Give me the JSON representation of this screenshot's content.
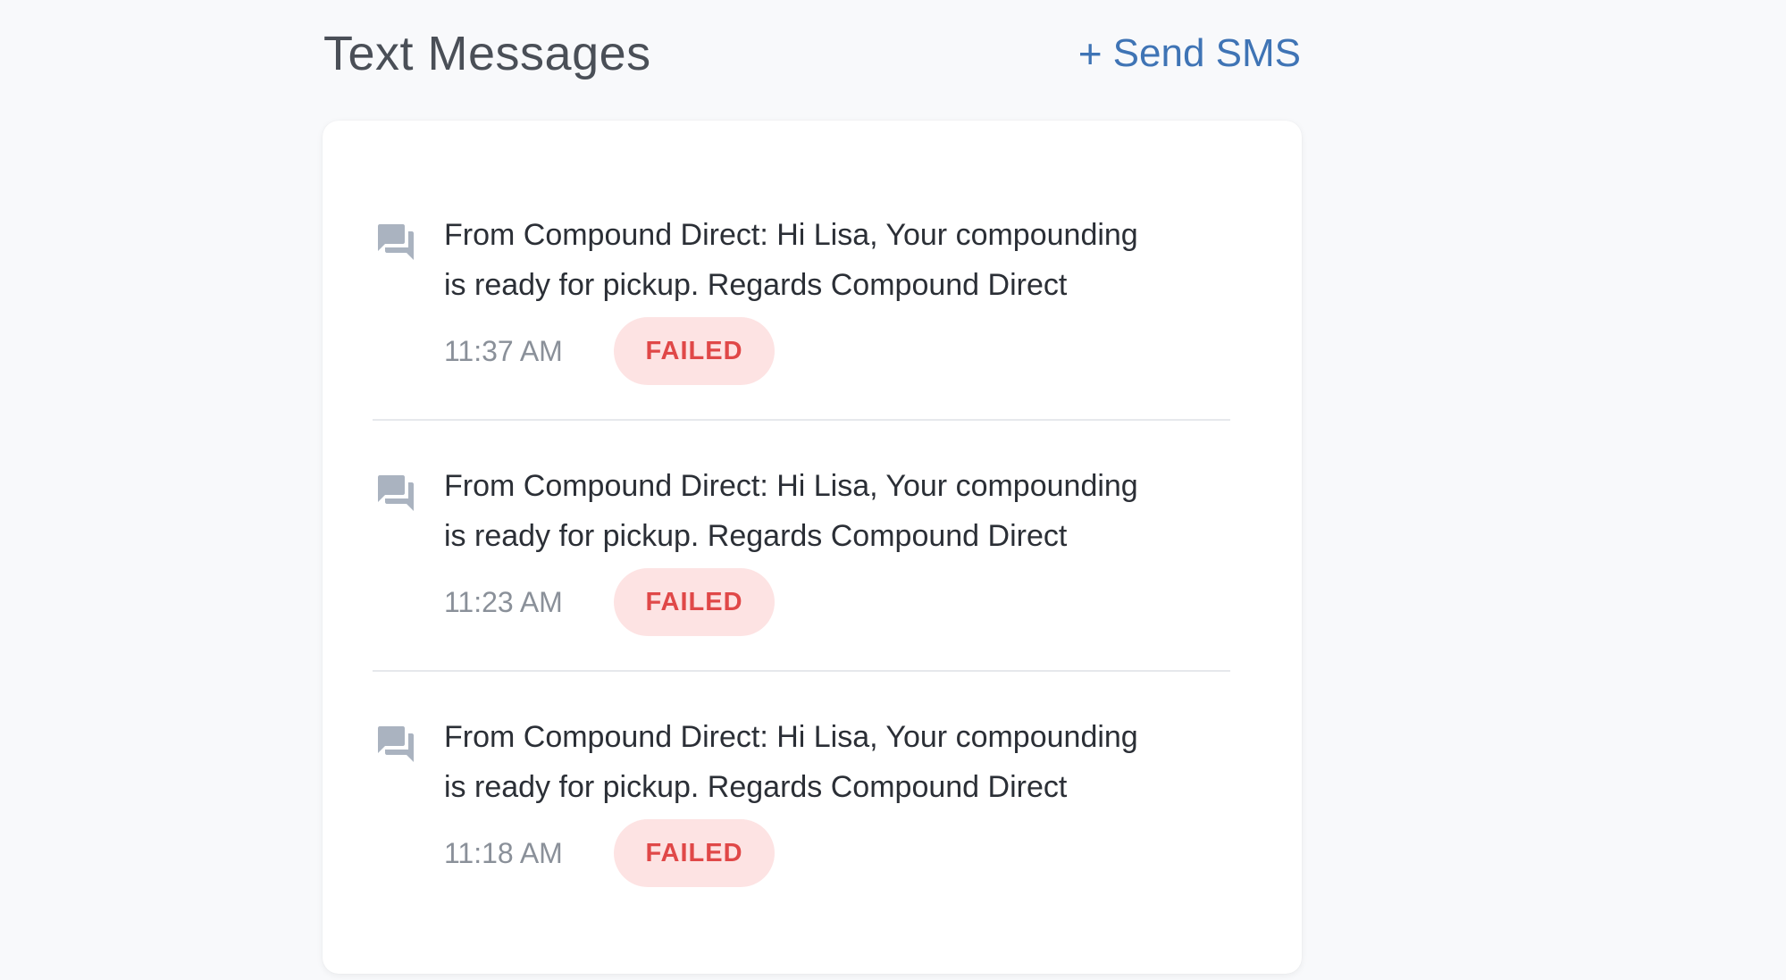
{
  "header": {
    "title": "Text Messages",
    "send_plus": "+",
    "send_label": "Send SMS"
  },
  "colors": {
    "accent": "#3f74b5",
    "failed_text": "#e04848",
    "failed_bg": "#fde3e3",
    "icon": "#aab3c0"
  },
  "messages": [
    {
      "icon": "chat-bubbles-icon",
      "line1": "From Compound Direct: Hi Lisa, Your compounding",
      "line2": "is ready for pickup. Regards Compound Direct",
      "time": "11:37 AM",
      "status": "FAILED"
    },
    {
      "icon": "chat-bubbles-icon",
      "line1": "From Compound Direct: Hi Lisa, Your compounding",
      "line2": "is ready for pickup. Regards Compound Direct",
      "time": "11:23 AM",
      "status": "FAILED"
    },
    {
      "icon": "chat-bubbles-icon",
      "line1": "From Compound Direct: Hi Lisa, Your compounding",
      "line2": "is ready for pickup. Regards Compound Direct",
      "time": "11:18 AM",
      "status": "FAILED"
    }
  ]
}
